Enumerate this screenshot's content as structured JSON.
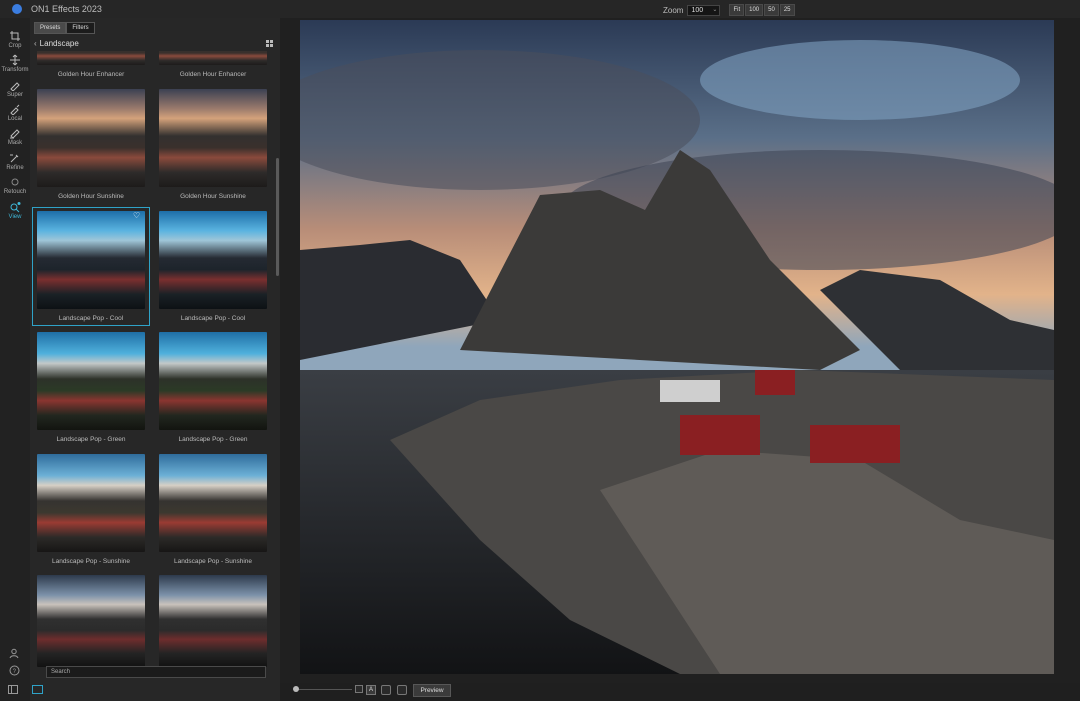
{
  "app": {
    "title": "ON1 Effects 2023"
  },
  "zoom": {
    "label": "Zoom",
    "value": "100",
    "buttons": [
      "Fit",
      "100",
      "50",
      "25"
    ]
  },
  "toolbar": {
    "items": [
      {
        "label": "Crop",
        "icon": "crop-icon"
      },
      {
        "label": "Transform",
        "icon": "transform-icon"
      },
      {
        "label": "Super",
        "icon": "super-brush-icon"
      },
      {
        "label": "Local",
        "icon": "local-brush-icon"
      },
      {
        "label": "Mask",
        "icon": "mask-icon"
      },
      {
        "label": "Refine",
        "icon": "refine-icon"
      },
      {
        "label": "Retouch",
        "icon": "retouch-icon"
      },
      {
        "label": "View",
        "icon": "view-icon",
        "active": true
      }
    ]
  },
  "panel": {
    "tabs": [
      {
        "label": "Presets",
        "active": true
      },
      {
        "label": "Filters",
        "active": false
      }
    ],
    "breadcrumb": "Landscape",
    "tiles": [
      {
        "caption": "Golden Hour Enhancer"
      },
      {
        "caption": "Golden Hour Enhancer"
      },
      {
        "caption": "Golden Hour Sunshine"
      },
      {
        "caption": "Golden Hour Sunshine"
      },
      {
        "caption": "Landscape Pop - Cool",
        "selected": true
      },
      {
        "caption": "Landscape Pop - Cool"
      },
      {
        "caption": "Landscape Pop - Green"
      },
      {
        "caption": "Landscape Pop - Green"
      },
      {
        "caption": "Landscape Pop - Sunshine"
      },
      {
        "caption": "Landscape Pop - Sunshine"
      },
      {
        "caption": ""
      },
      {
        "caption": ""
      }
    ],
    "search_placeholder": "Search"
  },
  "bottom": {
    "preview_label": "Preview",
    "channel_label": "A"
  },
  "colors": {
    "accent": "#2fa3c8",
    "bg": "#1f1f1f",
    "panel": "#272727"
  }
}
